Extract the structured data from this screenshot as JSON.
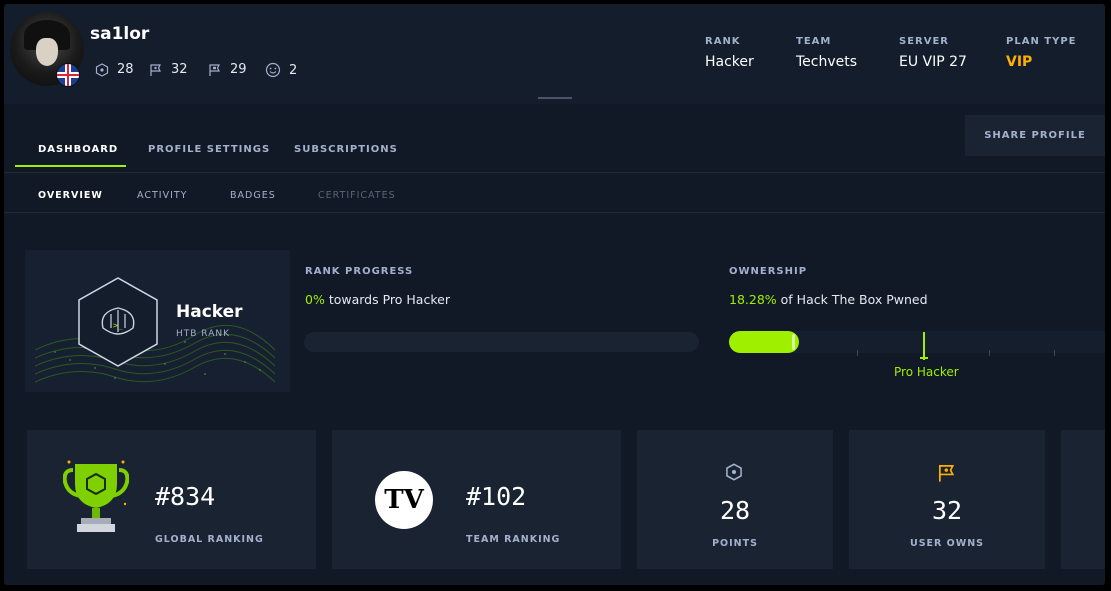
{
  "profile": {
    "username": "sa1lor",
    "stats": [
      {
        "icon": "points-icon",
        "value": "28"
      },
      {
        "icon": "user-owns-icon",
        "value": "32"
      },
      {
        "icon": "system-owns-icon",
        "value": "29"
      },
      {
        "icon": "respect-icon",
        "value": "2"
      }
    ]
  },
  "header_info": [
    {
      "label": "RANK",
      "value": "Hacker"
    },
    {
      "label": "TEAM",
      "value": "Techvets"
    },
    {
      "label": "SERVER",
      "value": "EU VIP 27"
    },
    {
      "label": "PLAN TYPE",
      "value": "VIP"
    }
  ],
  "tabs": [
    "DASHBOARD",
    "PROFILE SETTINGS",
    "SUBSCRIPTIONS"
  ],
  "share_label": "SHARE PROFILE",
  "subtabs": [
    "OVERVIEW",
    "ACTIVITY",
    "BADGES",
    "CERTIFICATES"
  ],
  "rank_card": {
    "name": "Hacker",
    "subtitle": "HTB RANK"
  },
  "rank_progress": {
    "label": "RANK PROGRESS",
    "percent": "0%",
    "text": "towards Pro Hacker",
    "fraction": 0
  },
  "ownership": {
    "label": "OWNERSHIP",
    "percent": "18.28%",
    "text": "of Hack The Box Pwned",
    "fraction": 0.1828,
    "marker_label": "Pro Hacker"
  },
  "cards": [
    {
      "icon": "trophy-icon",
      "value": "#834",
      "label": "GLOBAL RANKING"
    },
    {
      "icon": "team-logo-icon",
      "logo_text": "TV",
      "value": "#102",
      "label": "TEAM RANKING"
    },
    {
      "icon": "points-icon",
      "value": "28",
      "label": "POINTS"
    },
    {
      "icon": "user-owns-icon",
      "value": "32",
      "label": "USER OWNS"
    }
  ],
  "colors": {
    "accent": "#9fef00",
    "vip": "#ffaf00",
    "background": "#111927"
  }
}
